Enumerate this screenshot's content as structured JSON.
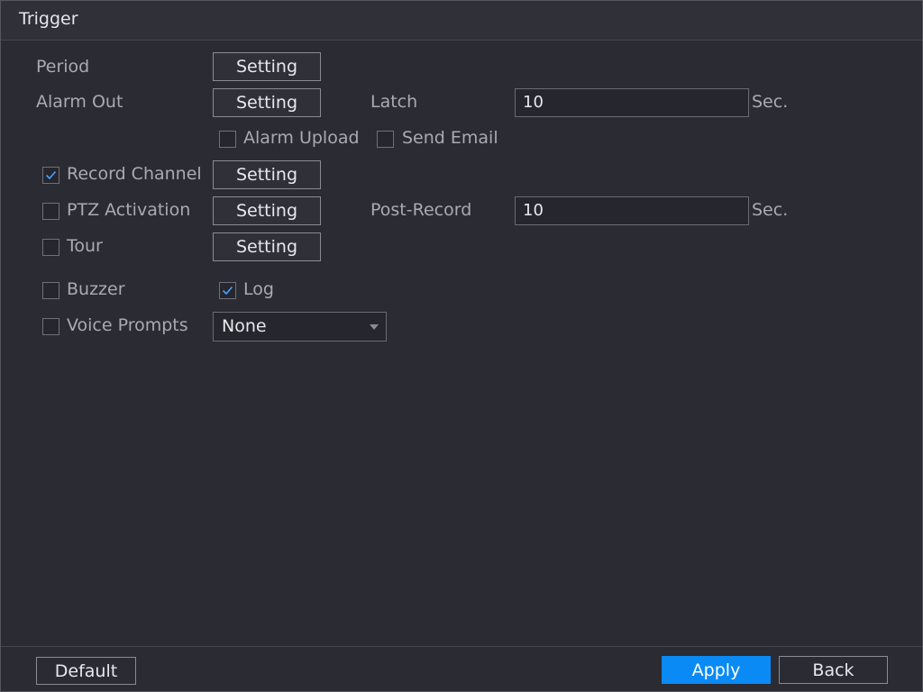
{
  "title": "Trigger",
  "rows": {
    "period": {
      "label": "Period",
      "button": "Setting"
    },
    "alarm_out": {
      "label": "Alarm Out",
      "button": "Setting",
      "latch_label": "Latch",
      "latch_value": "10",
      "latch_unit": "Sec."
    },
    "alarm_upload": {
      "label": "Alarm Upload",
      "checked": false
    },
    "send_email": {
      "label": "Send Email",
      "checked": false
    },
    "record_channel": {
      "label": "Record Channel",
      "checked": true,
      "button": "Setting"
    },
    "ptz_activation": {
      "label": "PTZ Activation",
      "checked": false,
      "button": "Setting",
      "post_record_label": "Post-Record",
      "post_record_value": "10",
      "post_record_unit": "Sec."
    },
    "tour": {
      "label": "Tour",
      "checked": false,
      "button": "Setting"
    },
    "buzzer": {
      "label": "Buzzer",
      "checked": false
    },
    "log": {
      "label": "Log",
      "checked": true
    },
    "voice_prompts": {
      "label": "Voice Prompts",
      "checked": false,
      "selected": "None"
    }
  },
  "footer": {
    "default_label": "Default",
    "apply_label": "Apply",
    "back_label": "Back"
  },
  "colors": {
    "accent": "#0a8af5",
    "check": "#4aa3ff",
    "background": "#2a2b33"
  }
}
